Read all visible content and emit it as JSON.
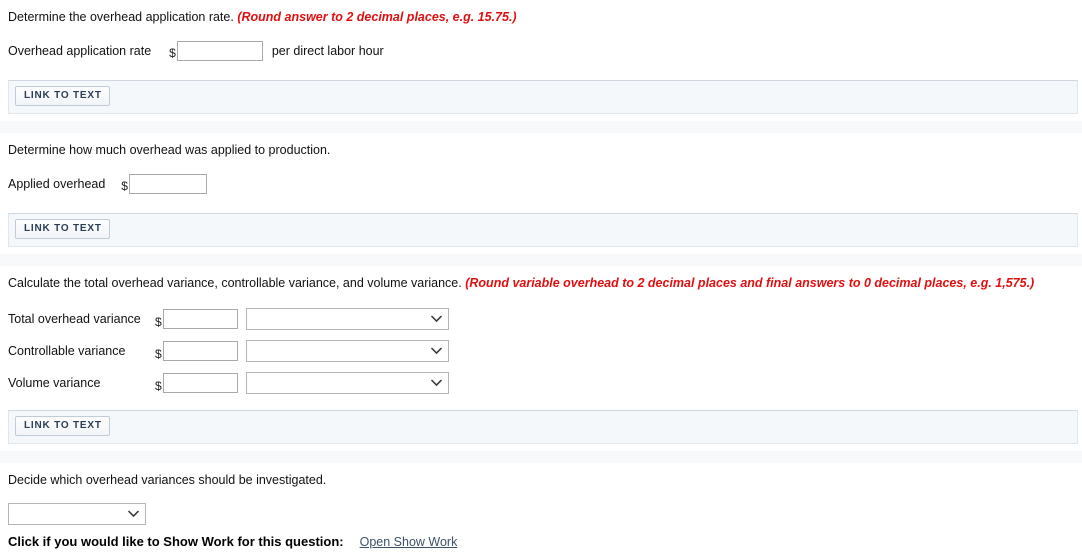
{
  "sections": [
    {
      "prompt": "Determine the overhead application rate.",
      "hint": "(Round answer to 2 decimal places, e.g. 15.75.)",
      "rows": [
        {
          "label": "Overhead application rate",
          "currency": "$",
          "value": "",
          "suffix": "per direct labor hour"
        }
      ],
      "link_button": "LINK TO TEXT"
    },
    {
      "prompt": "Determine how much overhead was applied to production.",
      "hint": "",
      "rows": [
        {
          "label": "Applied overhead",
          "currency": "$",
          "value": "",
          "suffix": ""
        }
      ],
      "link_button": "LINK TO TEXT"
    },
    {
      "prompt": "Calculate the total overhead variance, controllable variance, and volume variance.",
      "hint": "(Round variable overhead to 2 decimal places and final answers to 0 decimal places, e.g. 1,575.)",
      "rows": [
        {
          "label": "Total overhead variance",
          "currency": "$",
          "value": "",
          "select_value": ""
        },
        {
          "label": "Controllable variance",
          "currency": "$",
          "value": "",
          "select_value": ""
        },
        {
          "label": "Volume variance",
          "currency": "$",
          "value": "",
          "select_value": ""
        }
      ],
      "link_button": "LINK TO TEXT"
    },
    {
      "prompt": "Decide which overhead variances should be investigated.",
      "hint": "",
      "select_value": ""
    }
  ],
  "footer": {
    "label": "Click if you would like to Show Work for this question:",
    "link": "Open Show Work"
  },
  "icons": {
    "chevron": "chevron-down-icon"
  },
  "colors": {
    "hint_red": "#e01010",
    "panel_bg": "#f4f8fb",
    "link": "#3c5168"
  }
}
